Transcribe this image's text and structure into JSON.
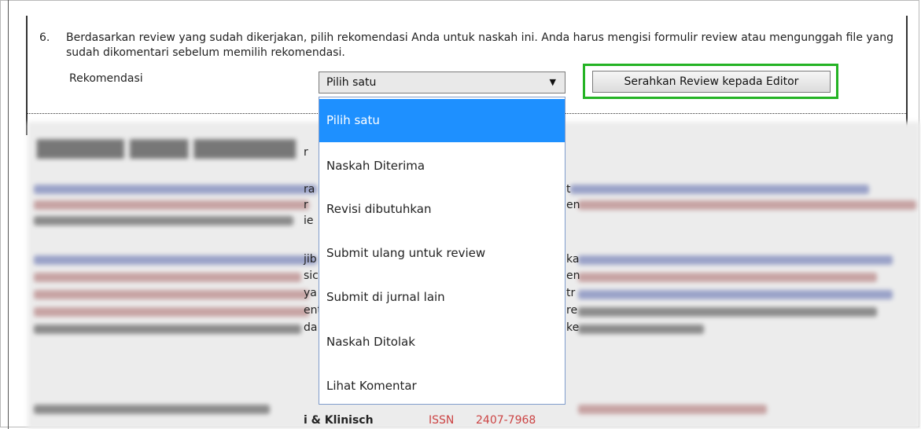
{
  "step": {
    "number": "6.",
    "text": "Berdasarkan review yang sudah dikerjakan, pilih rekomendasi Anda untuk naskah ini. Anda harus mengisi formulir review atau mengunggah file yang sudah dikomentari sebelum memilih rekomendasi."
  },
  "recommendation": {
    "label": "Rekomendasi",
    "selected": "Pilih satu",
    "caret_icon": "triangle-down",
    "options": [
      "Pilih satu",
      "Naskah Diterima",
      "Revisi dibutuhkan",
      "Submit ulang untuk review",
      "Submit di jurnal lain",
      "Naskah Ditolak",
      "Lihat Komentar"
    ]
  },
  "submit_button": {
    "label": "Serahkan Review kepada Editor"
  },
  "visible_fragments": [
    "ra",
    "r",
    "ie",
    "jib",
    "sic",
    "ya",
    "ent",
    "da",
    "t",
    "ka",
    "en",
    "tr",
    "re",
    "ke",
    "ISSN",
    "2407-7968",
    "i & Klinisch"
  ],
  "colors": {
    "highlight": "#24b324",
    "selected_option": "#1e90ff",
    "dropdown_border": "#7f9ccb"
  }
}
